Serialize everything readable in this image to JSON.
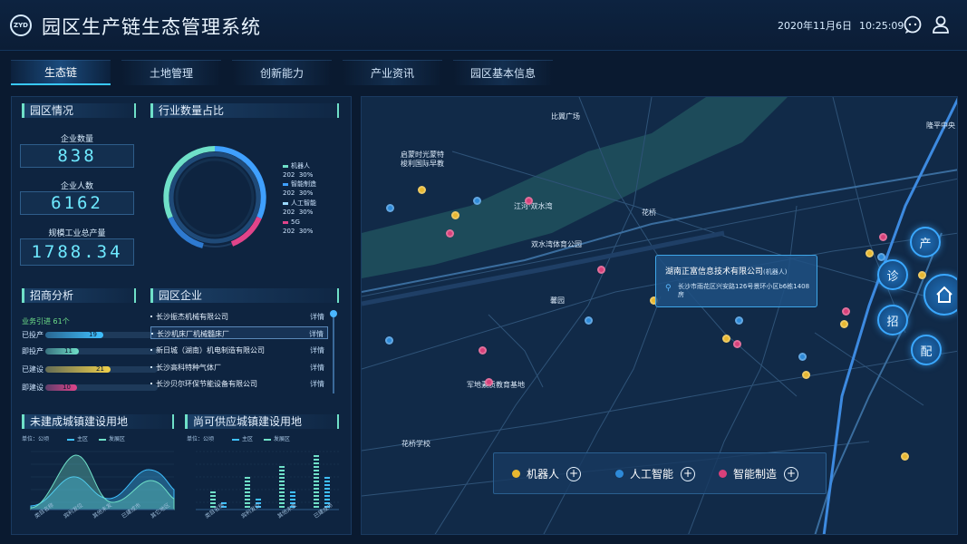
{
  "header": {
    "logo_text": "ZYD",
    "title": "园区生产链生态管理系统",
    "date": "2020年11月6日",
    "time": "10:25:09",
    "icons": [
      "chat-icon",
      "user-icon"
    ]
  },
  "tabs": [
    {
      "label": "生态链",
      "active": true
    },
    {
      "label": "土地管理",
      "active": false
    },
    {
      "label": "创新能力",
      "active": false
    },
    {
      "label": "产业资讯",
      "active": false
    },
    {
      "label": "园区基本信息",
      "active": false
    }
  ],
  "park_overview": {
    "title": "园区情况",
    "stats": [
      {
        "label": "企业数量",
        "value": "838"
      },
      {
        "label": "企业人数",
        "value": "6162"
      },
      {
        "label": "规模工业总产量",
        "value": "1788.34"
      }
    ]
  },
  "industry_ratio": {
    "title": "行业数量占比",
    "legend": [
      {
        "name": "机器人",
        "value": "202",
        "percent": "30%",
        "color": "#6fe0c8"
      },
      {
        "name": "智能制造",
        "value": "202",
        "percent": "30%",
        "color": "#3fa0ff"
      },
      {
        "name": "人工智能",
        "value": "202",
        "percent": "30%",
        "color": "#9ad8ff"
      },
      {
        "name": "5G",
        "value": "202",
        "percent": "30%",
        "color": "#e0448a"
      }
    ]
  },
  "investment": {
    "title": "招商分析",
    "subtitle": "业务引进 61个",
    "bars": [
      {
        "label": "已投产",
        "value": "19",
        "fraction": 0.52,
        "color": "#3fc0ff"
      },
      {
        "label": "即投产",
        "value": "11",
        "fraction": 0.3,
        "color": "#6fe0c8"
      },
      {
        "label": "已建设",
        "value": "21",
        "fraction": 0.58,
        "color": "#f0d04a"
      },
      {
        "label": "即建设",
        "value": "10",
        "fraction": 0.28,
        "color": "#e0448a"
      }
    ]
  },
  "park_companies": {
    "title": "园区企业",
    "detail_label": "详情",
    "items": [
      "长沙振杰机械有限公司",
      "长沙机床厂机械髓床厂",
      "新日城（湖南）机电制造有限公司",
      "长沙高科特种气体厂",
      "长沙贝尔环保节能设备有限公司"
    ]
  },
  "unbuilt_land": {
    "title": "未建成城镇建设用地",
    "unit": "单位：公顷",
    "legend": [
      "主区",
      "发展区"
    ],
    "x_labels": [
      "类目名称",
      "宾利发位",
      "其他未发",
      "已建成市",
      "其它地区"
    ],
    "legend_colors": [
      "#3fc0ff",
      "#6fe0c8"
    ]
  },
  "available_land": {
    "title": "尚可供应城镇建设用地",
    "unit": "单位：公顷",
    "legend": [
      "主区",
      "发展区"
    ],
    "x_labels": [
      "类目名称",
      "宾利发位",
      "其他未发",
      "已建成市"
    ],
    "legend_colors": [
      "#3fc0ff",
      "#6fe0c8"
    ]
  },
  "map": {
    "labels": [
      "比翼广场",
      "隆平中央",
      "启蒙时光蒙特",
      "梭利国际早教",
      "江河·双水湾",
      "花桥",
      "双水湾体育公园",
      "馨园",
      "军地素质教育基地",
      "花桥学校"
    ],
    "popup": {
      "company": "湖南正富信息技术有限公司",
      "category": "(机器人)",
      "address": "长沙市雨花区兴安路126号景环小区b6栋1408房"
    },
    "nav_buttons": [
      "产",
      "诊",
      "招",
      "配"
    ],
    "home_icon": "home-icon",
    "legend": [
      {
        "label": "机器人",
        "color": "#e8b830"
      },
      {
        "label": "人工智能",
        "color": "#2e8ad8"
      },
      {
        "label": "智能制造",
        "color": "#d8407a"
      }
    ]
  }
}
